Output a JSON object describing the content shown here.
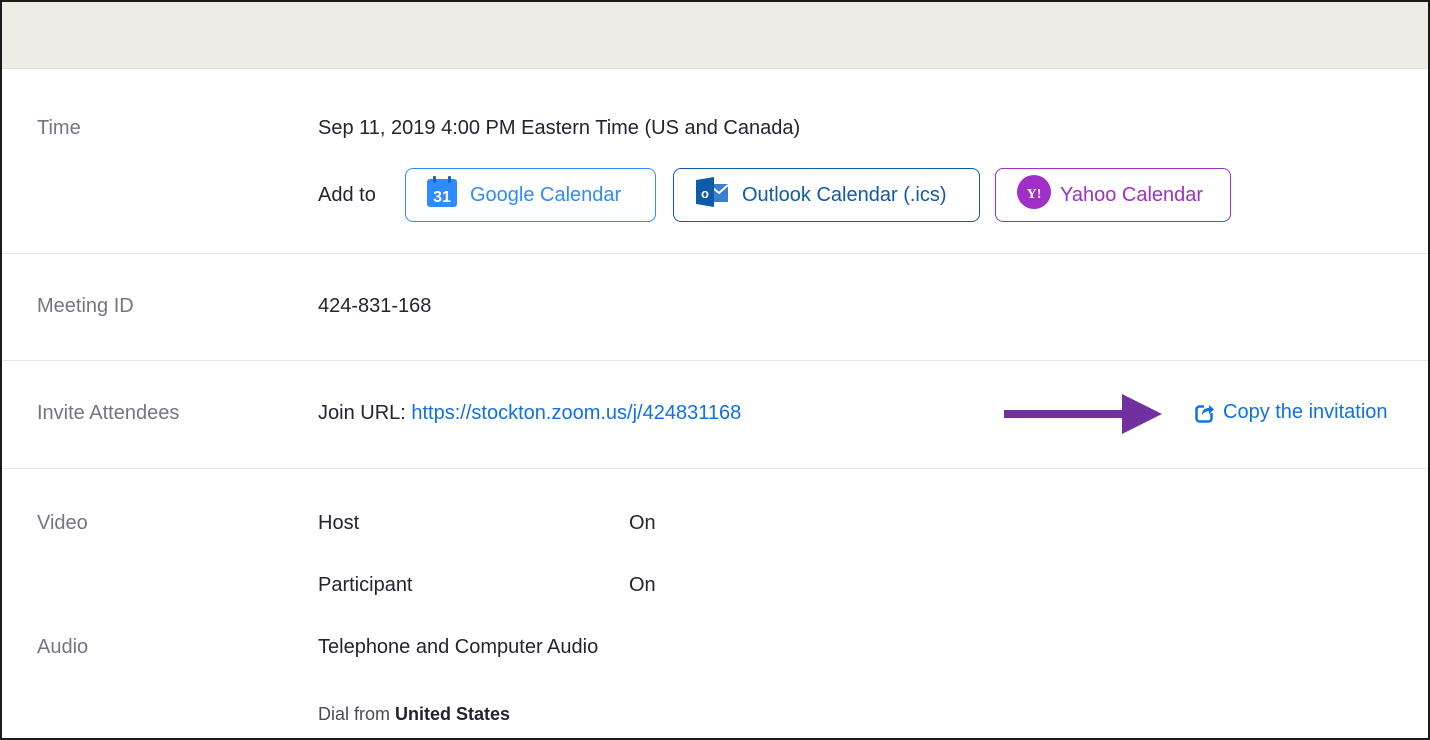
{
  "meeting": {
    "time": {
      "label": "Time",
      "value": "Sep 11, 2019 4:00 PM Eastern Time (US and Canada)",
      "add_to_label": "Add to",
      "calendars": {
        "google": {
          "label": "Google Calendar",
          "icon": "google-calendar-icon",
          "icon_text": "31",
          "color": "#2d8cff"
        },
        "outlook": {
          "label": "Outlook Calendar (.ics)",
          "icon": "outlook-icon",
          "icon_text": "o",
          "color": "#0e5ca8"
        },
        "yahoo": {
          "label": "Yahoo Calendar",
          "icon": "yahoo-icon",
          "icon_text": "Y!",
          "color": "#a02ec7"
        }
      }
    },
    "meeting_id": {
      "label": "Meeting ID",
      "value": "424-831-168"
    },
    "invite": {
      "label": "Invite Attendees",
      "join_prefix": "Join URL:",
      "join_url": "https://stockton.zoom.us/j/424831168",
      "copy_label": "Copy the invitation",
      "arrow_color": "#7030a0"
    },
    "video": {
      "label": "Video",
      "host_label": "Host",
      "host_value": "On",
      "participant_label": "Participant",
      "participant_value": "On"
    },
    "audio": {
      "label": "Audio",
      "value": "Telephone and Computer Audio",
      "dial_prefix": "Dial from",
      "dial_country": "United States"
    }
  }
}
